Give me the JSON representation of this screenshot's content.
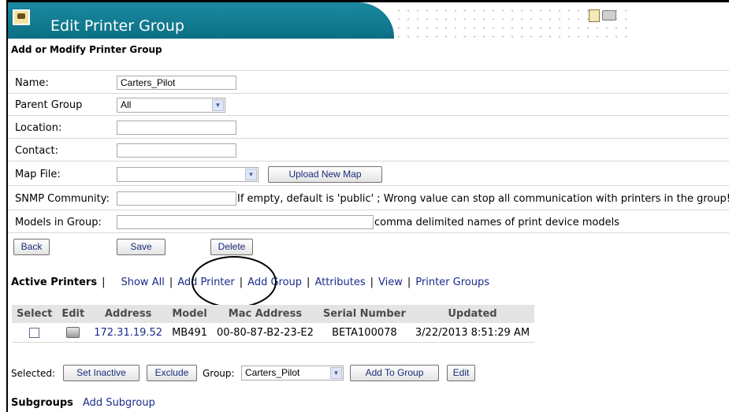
{
  "header": {
    "title": "Edit Printer Group"
  },
  "subtitle": "Add or Modify Printer Group",
  "form": {
    "name_label": "Name:",
    "name_value": "Carters_Pilot",
    "parent_label": "Parent Group",
    "parent_value": "All",
    "location_label": "Location:",
    "location_value": "",
    "contact_label": "Contact:",
    "contact_value": "",
    "mapfile_label": "Map File:",
    "mapfile_value": "",
    "upload_label": "Upload New Map",
    "snmp_label": "SNMP Community:",
    "snmp_value": "",
    "snmp_note": "If empty, default is 'public' ; Wrong value can stop all communication with printers in the group!",
    "models_label": "Models in Group:",
    "models_value": "",
    "models_note": "comma delimited names of print device models",
    "back_label": "Back",
    "save_label": "Save",
    "delete_label": "Delete"
  },
  "actions": {
    "active_printers": "Active Printers",
    "show_all": "Show All",
    "add_printer": "Add Printer",
    "add_group": "Add Group",
    "attributes": "Attributes",
    "view": "View",
    "printer_groups": "Printer Groups"
  },
  "table": {
    "headers": [
      "Select",
      "Edit",
      "Address",
      "Model",
      "Mac Address",
      "Serial Number",
      "Updated"
    ],
    "rows": [
      {
        "address": "172.31.19.52",
        "model": "MB491",
        "mac": "00-80-87-B2-23-E2",
        "serial": "BETA100078",
        "updated": "3/22/2013 8:51:29 AM"
      }
    ]
  },
  "bottom": {
    "selected_label": "Selected:",
    "set_inactive": "Set Inactive",
    "exclude": "Exclude",
    "group_label": "Group:",
    "group_value": "Carters_Pilot",
    "add_to_group": "Add To Group",
    "edit": "Edit"
  },
  "subgroups": {
    "title": "Subgroups",
    "add": "Add Subgroup"
  }
}
